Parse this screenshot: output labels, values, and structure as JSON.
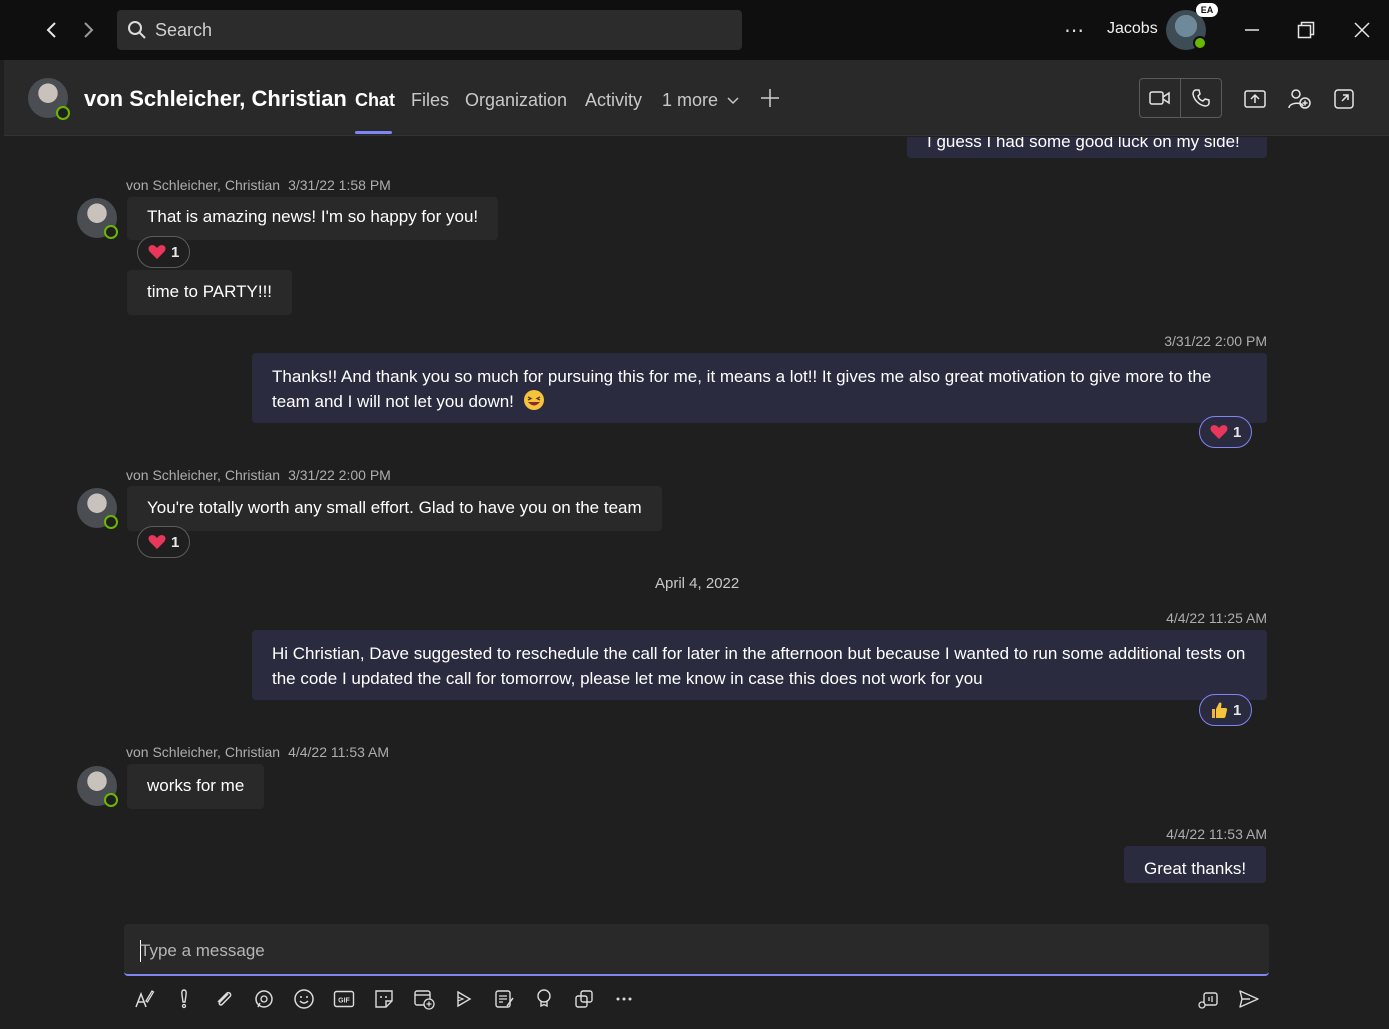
{
  "titlebar": {
    "search_label": "Search",
    "more_label": "⋯",
    "username": "Jacobs",
    "initials": "EA"
  },
  "header": {
    "contact_name": "von Schleicher, Christian",
    "tabs": [
      "Chat",
      "Files",
      "Organization",
      "Activity",
      "1 more"
    ]
  },
  "messages": {
    "partial_top": "I guess I had some good luck on my side!",
    "m1": {
      "sender": "von Schleicher, Christian",
      "time": "3/31/22 1:58 PM",
      "text": "That is amazing news! I'm so happy for you!",
      "reaction_count": "1"
    },
    "m2": {
      "text": "time to PARTY!!!"
    },
    "m3": {
      "time": "3/31/22 2:00 PM",
      "text": "Thanks!! And thank you so much for pursuing this for me, it means a lot!! It gives me also great motivation to give more to the team and I will not let you down!",
      "emoji": "😆",
      "reaction_count": "1"
    },
    "m4": {
      "sender": "von Schleicher, Christian",
      "time": "3/31/22 2:00 PM",
      "text": "You're totally worth any small effort. Glad to have you on the team",
      "reaction_count": "1"
    },
    "date_separator": "April 4, 2022",
    "m5": {
      "time": "4/4/22 11:25 AM",
      "text": "Hi Christian, Dave suggested to reschedule the call for later in the afternoon but because I wanted to run some additional tests on the code I updated the call for tomorrow, please let me know in case this does not work for you",
      "reaction_count": "1"
    },
    "m6": {
      "sender": "von Schleicher, Christian",
      "time": "4/4/22 11:53 AM",
      "text": "works for me"
    },
    "m7": {
      "time": "4/4/22 11:53 AM",
      "text": "Great thanks!"
    }
  },
  "compose": {
    "placeholder": "Type a message"
  },
  "colors": {
    "accent": "#7f85f5",
    "presence": "#6bb700",
    "background": "#1f1f1f",
    "own_bubble": "#2b2b40",
    "other_bubble": "#292929"
  }
}
